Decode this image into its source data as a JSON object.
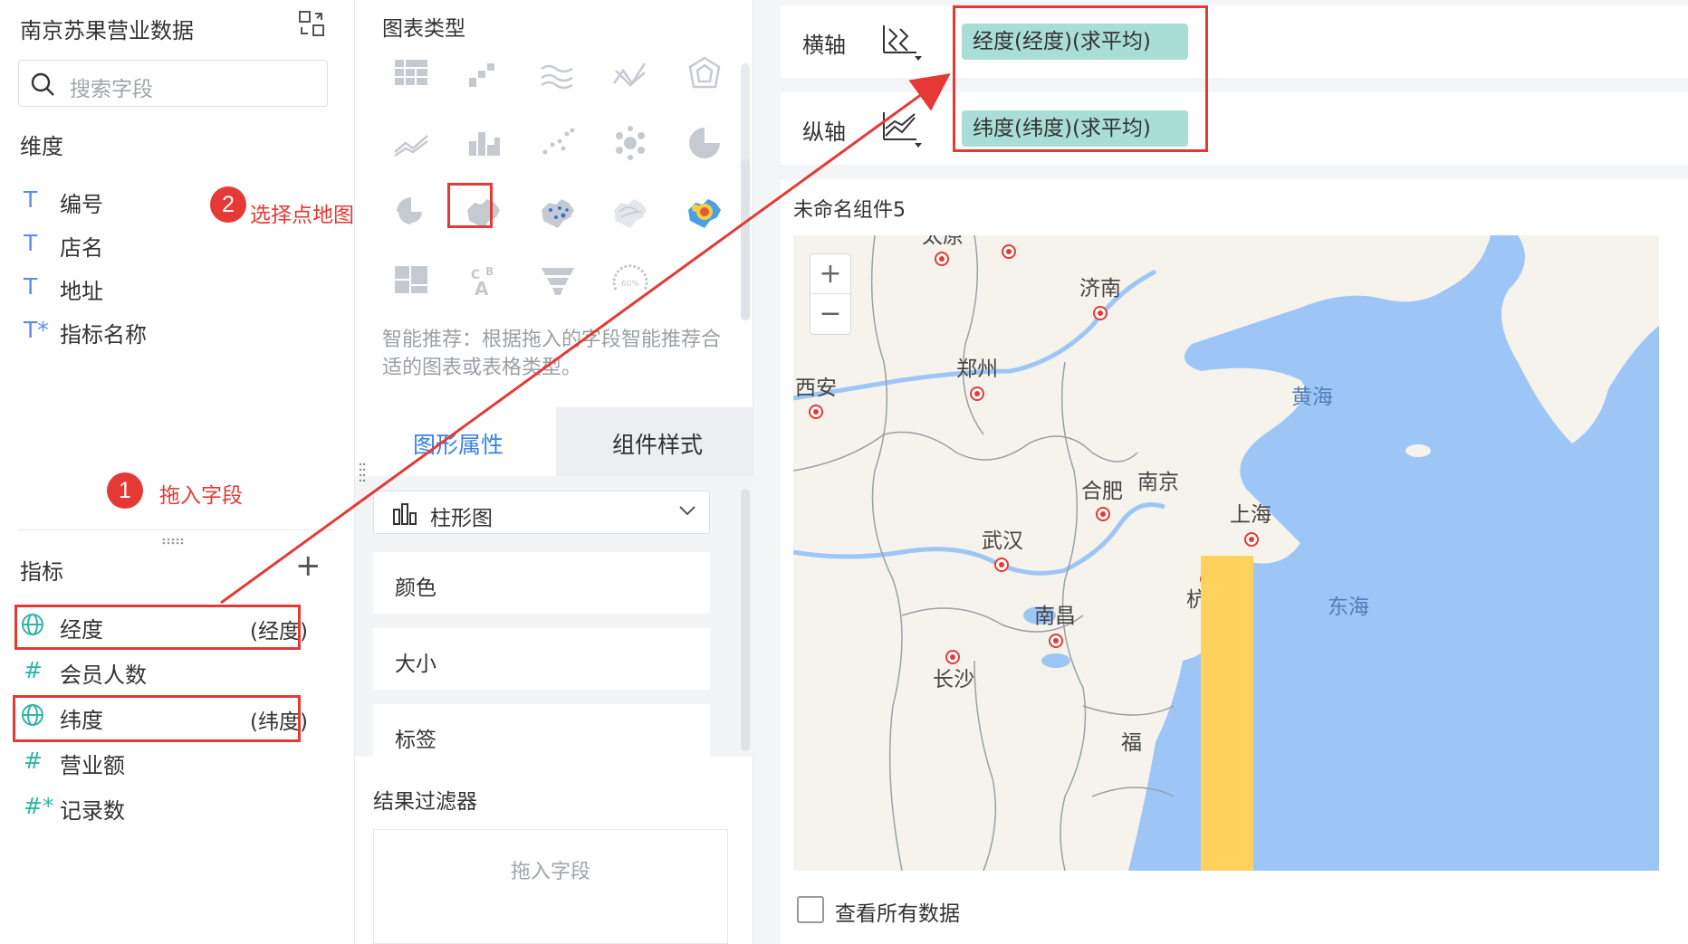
{
  "dataset": {
    "title": "南京苏果营业数据",
    "search_placeholder": "搜索字段"
  },
  "dimensions": {
    "label": "维度",
    "items": [
      {
        "type_icon": "T",
        "name": "编号"
      },
      {
        "type_icon": "T",
        "name": "店名"
      },
      {
        "type_icon": "T",
        "name": "地址"
      },
      {
        "type_icon": "T*",
        "name": "指标名称"
      }
    ]
  },
  "measures": {
    "label": "指标",
    "items": [
      {
        "icon": "globe-icon",
        "name": "经度",
        "alias": "(经度)"
      },
      {
        "icon": "hash-icon",
        "type_icon": "#",
        "name": "会员人数"
      },
      {
        "icon": "globe-icon",
        "name": "纬度",
        "alias": "(纬度)"
      },
      {
        "icon": "hash-icon",
        "type_icon": "#",
        "name": "营业额"
      },
      {
        "icon": "hash-icon",
        "type_icon": "#*",
        "name": "记录数"
      }
    ]
  },
  "annotations": {
    "step1_number": "1",
    "step1_text": "拖入字段",
    "step2_number": "2",
    "step2_text": "选择点地图",
    "color": "#e53935"
  },
  "chart_types": {
    "title": "图表类型",
    "hint": "智能推荐：根据拖入的字段智能推荐合适的图表或表格类型。",
    "gauge_text": "60%",
    "selected": "point-map"
  },
  "property_tabs": {
    "active": "图形属性",
    "other": "组件样式"
  },
  "graph_props": {
    "chart_select": "柱形图",
    "items": [
      "颜色",
      "大小",
      "标签"
    ]
  },
  "result_filter": {
    "title": "结果过滤器",
    "drop_hint": "拖入字段"
  },
  "axes": {
    "x_label": "横轴",
    "x_field": "经度(经度)(求平均)",
    "y_label": "纵轴",
    "y_field": "纬度(纬度)(求平均)",
    "pill_color": "#a8ded6"
  },
  "widget": {
    "title": "未命名组件5",
    "zoom_in": "+",
    "zoom_out": "−",
    "view_all_label": "查看所有数据",
    "bar_color": "#ffd25e"
  },
  "map_labels": {
    "taiyuan": "太原",
    "jinan": "济南",
    "zhengzhou": "郑州",
    "xian": "西安",
    "hefei": "合肥",
    "nanjing": "南京",
    "shanghai": "上海",
    "wuhan": "武汉",
    "hangzhou": "杭州",
    "nanchang": "南昌",
    "changsha": "长沙",
    "fu": "福",
    "yellow_sea": "黄海",
    "east_sea": "东海"
  },
  "colors": {
    "accent": "#3a80e8",
    "sea": "#9dc6f7",
    "land": "#f5f3ec"
  }
}
